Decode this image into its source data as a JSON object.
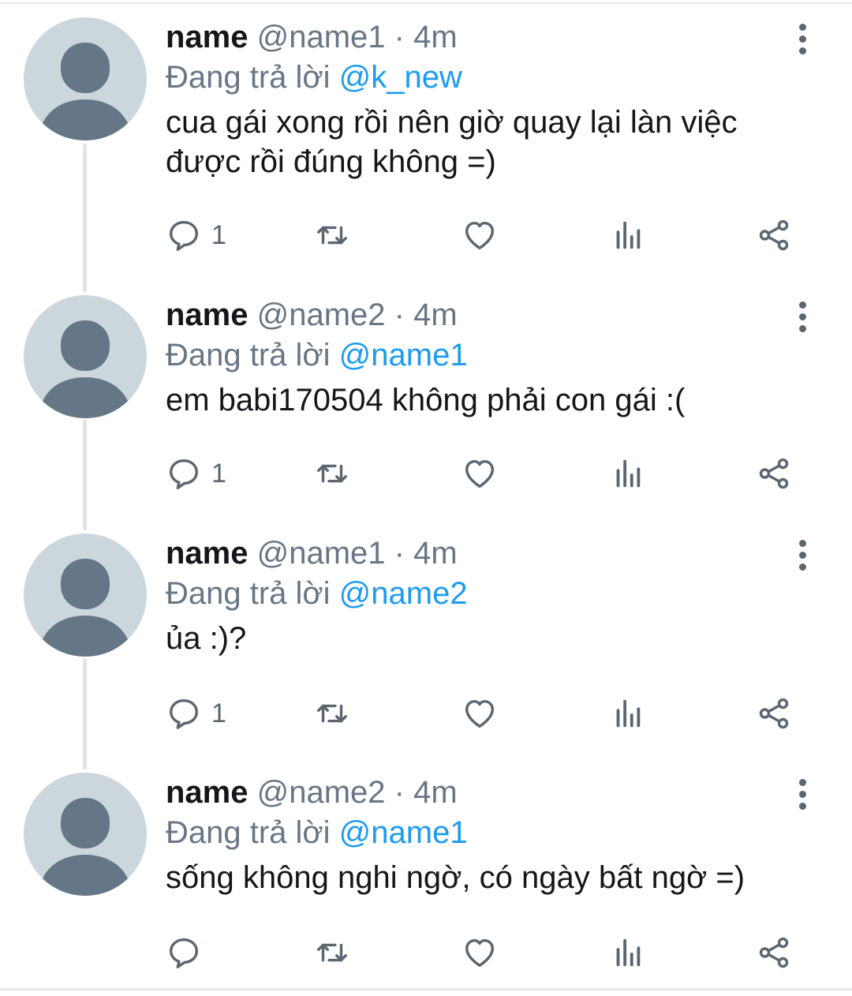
{
  "tweets": [
    {
      "name": "name",
      "handle": "@name1",
      "separator": "·",
      "time": "4m",
      "reply_prefix": "Đang trả lời",
      "reply_to": "@k_new",
      "text_lines": [
        "cua gái xong rồi nên giờ quay lại làn việc",
        "được rồi đúng không =)"
      ],
      "reply_count": "1"
    },
    {
      "name": "name",
      "handle": "@name2",
      "separator": "·",
      "time": "4m",
      "reply_prefix": "Đang trả lời",
      "reply_to": "@name1",
      "text_lines": [
        "em babi170504 không phải con gái :("
      ],
      "reply_count": "1"
    },
    {
      "name": "name",
      "handle": "@name1",
      "separator": "·",
      "time": "4m",
      "reply_prefix": "Đang trả lời",
      "reply_to": "@name2",
      "text_lines": [
        "ủa :)?"
      ],
      "reply_count": "1"
    },
    {
      "name": "name",
      "handle": "@name2",
      "separator": "·",
      "time": "4m",
      "reply_prefix": "Đang trả lời",
      "reply_to": "@name1",
      "text_lines": [
        "sống không nghi ngờ, có ngày bất ngờ =)"
      ],
      "reply_count": ""
    }
  ],
  "icons": {
    "reply": "reply-icon",
    "retweet": "retweet-icon",
    "like": "heart-icon",
    "views": "analytics-icon",
    "share": "share-icon",
    "more": "more-vertical-icon",
    "avatar": "default-avatar-icon"
  },
  "colors": {
    "mention": "#1d9bf0",
    "secondary_text": "#687684",
    "avatar_bg": "#ccd6dd",
    "avatar_fg": "#657786",
    "thread_line": "#e0e4e8"
  }
}
